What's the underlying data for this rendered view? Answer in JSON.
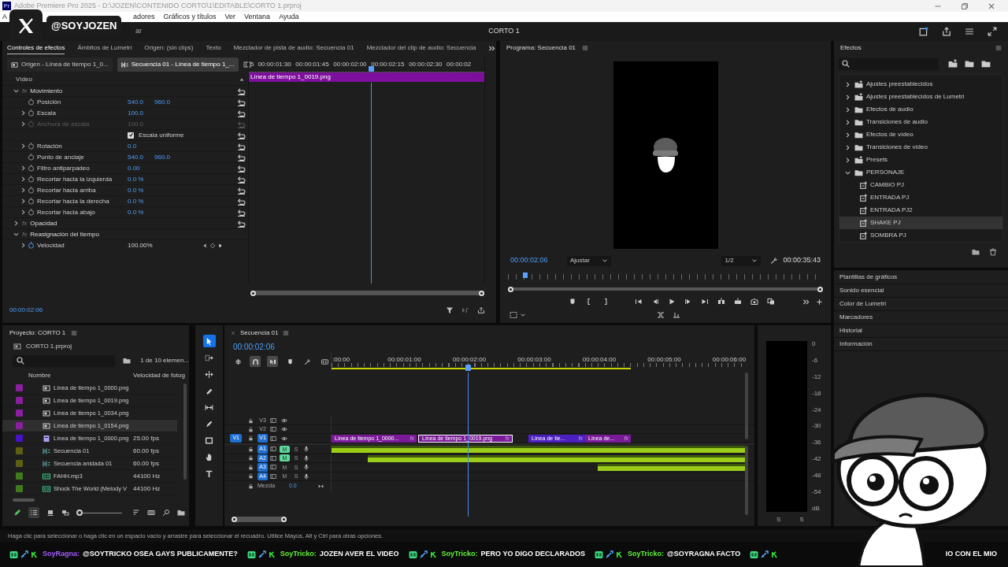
{
  "title_bar": {
    "app_icon": "Pr",
    "title": "Adobe Premiere Pro 2025 - D:\\JOZEN\\CONTENIDO CORTO\\1\\EDITABLE\\CORTO 1.prproj"
  },
  "menu": [
    "A",
    "adores",
    "Gráficos y títulos",
    "Ver",
    "Ventana",
    "Ayuda"
  ],
  "header": {
    "workspace_tab": "ar",
    "project": "CORTO 1"
  },
  "effect_controls": {
    "tabs": [
      {
        "label": "Controles de efectos",
        "selected": true
      },
      {
        "label": "Ámbitos de Lumetri",
        "selected": false
      },
      {
        "label": "Origen: (sin clips)",
        "selected": false
      },
      {
        "label": "Texto",
        "selected": false
      },
      {
        "label": "Mezclador de pista de audio: Secuencia 01",
        "selected": false
      },
      {
        "label": "Mezclador del clip de audio: Secuencia",
        "selected": false
      }
    ],
    "sources": [
      {
        "label": "Origen - Línea de tiempo 1_0...",
        "selected": false
      },
      {
        "label": "Secuencia 01 - Línea de tiempo 1_...",
        "selected": true
      }
    ],
    "section": "Vídeo",
    "effects": [
      {
        "name": "Movimiento",
        "fx": "fx",
        "expanded": true,
        "reset": true,
        "children": [
          {
            "kind": "property",
            "name": "Posición",
            "values": [
              "540.0",
              "960.0"
            ],
            "expandable": false,
            "disabled": false,
            "animated": false
          },
          {
            "kind": "property",
            "name": "Escala",
            "values": [
              "100.0"
            ],
            "expandable": true,
            "disabled": false,
            "animated": false
          },
          {
            "kind": "property",
            "name": "Anchura de escala",
            "values": [
              "100.0"
            ],
            "expandable": true,
            "disabled": true,
            "animated": false
          },
          {
            "kind": "checkbox",
            "label": "Escala uniforme",
            "checked": true
          },
          {
            "kind": "property",
            "name": "Rotación",
            "values": [
              "0.0"
            ],
            "expandable": true,
            "disabled": false,
            "animated": false
          },
          {
            "kind": "property",
            "name": "Punto de anclaje",
            "values": [
              "540.0",
              "960.0"
            ],
            "expandable": false,
            "disabled": false,
            "animated": false
          },
          {
            "kind": "property",
            "name": "Filtro antiparpadeo",
            "values": [
              "0.00"
            ],
            "expandable": true,
            "disabled": false,
            "animated": false
          },
          {
            "kind": "property",
            "name": "Recortar hacia la izquierda",
            "values": [
              "0.0 %"
            ],
            "expandable": true,
            "disabled": false,
            "animated": false
          },
          {
            "kind": "property",
            "name": "Recortar hacia arriba",
            "values": [
              "0.0 %"
            ],
            "expandable": true,
            "disabled": false,
            "animated": false
          },
          {
            "kind": "property",
            "name": "Recortar hacia la derecha",
            "values": [
              "0.0 %"
            ],
            "expandable": true,
            "disabled": false,
            "animated": false
          },
          {
            "kind": "property",
            "name": "Recortar hacia abajo",
            "values": [
              "0.0 %"
            ],
            "expandable": true,
            "disabled": false,
            "animated": false
          }
        ]
      },
      {
        "name": "Opacidad",
        "fx": "fx",
        "expanded": false,
        "reset": true
      },
      {
        "name": "Reasignación del tiempo",
        "fx": "fx",
        "expanded": true,
        "reset": false,
        "children": [
          {
            "kind": "property",
            "name": "Velocidad",
            "values": [
              "100.00%"
            ],
            "expandable": true,
            "disabled": false,
            "animated": true
          }
        ]
      }
    ],
    "ruler": [
      "5",
      "00:00:01:30",
      "00:00:01:45",
      "00:00:02:00",
      "00:00:02:15",
      "00:00:02:30",
      "00:00:02"
    ],
    "clip": "Línea de tiempo 1_0019.png",
    "timecode": "00:00:02:06"
  },
  "program": {
    "title": "Programa: Secuencia 01",
    "timecode": "00:00:02:06",
    "fit": "Ajustar",
    "resolution": "1/2",
    "duration": "00:00:35:43"
  },
  "effects_panel": {
    "title": "Efectos",
    "items": [
      {
        "label": "Ajustes preestablecidos",
        "kind": "preset_bin",
        "expanded": false,
        "selected": false
      },
      {
        "label": "Ajustes preestablecidos de Lumetri",
        "kind": "preset_bin",
        "expanded": false,
        "selected": false
      },
      {
        "label": "Efectos de audio",
        "kind": "folder",
        "expanded": false,
        "selected": false
      },
      {
        "label": "Transiciones de audio",
        "kind": "folder",
        "expanded": false,
        "selected": false
      },
      {
        "label": "Efectos de vídeo",
        "kind": "folder",
        "expanded": false,
        "selected": false
      },
      {
        "label": "Transiciones de vídeo",
        "kind": "folder",
        "expanded": false,
        "selected": false
      },
      {
        "label": "Presets",
        "kind": "preset_bin",
        "expanded": false,
        "selected": false
      },
      {
        "label": "PERSONAJE",
        "kind": "folder",
        "expanded": true,
        "selected": false,
        "children": [
          {
            "label": "CAMBIO PJ",
            "kind": "preset",
            "selected": false
          },
          {
            "label": "ENTRADA PJ",
            "kind": "preset",
            "selected": false
          },
          {
            "label": "ENTRADA PJ2",
            "kind": "preset",
            "selected": false
          },
          {
            "label": "SHAKE PJ",
            "kind": "preset",
            "selected": true
          },
          {
            "label": "SOMBRA PJ",
            "kind": "preset",
            "selected": false
          }
        ]
      }
    ]
  },
  "side_panels": [
    "Plantillas de gráficos",
    "Sonido esencial",
    "Color de Lumetri",
    "Marcadores",
    "Historial",
    "Información"
  ],
  "project": {
    "title": "Proyecto: CORTO 1",
    "file": "CORTO 1.prproj",
    "count": "1 de 10 elemen...",
    "columns": [
      "Nombre",
      "Velocidad de fotog"
    ],
    "rows": [
      {
        "name": "Línea de tiempo 1_0000.png",
        "kind": "image",
        "color": "#8a1fa0",
        "selected": false
      },
      {
        "name": "Línea de tiempo 1_0019.png",
        "kind": "image",
        "color": "#8a1fa0",
        "selected": false
      },
      {
        "name": "Línea de tiempo 1_0034.png",
        "kind": "image",
        "color": "#8a1fa0",
        "selected": false
      },
      {
        "name": "Línea de tiempo 1_0154.png",
        "kind": "image",
        "color": "#8a1fa0",
        "selected": true
      },
      {
        "name": "Línea de tiempo 1_0000.png",
        "rate": "25.00 fps",
        "kind": "graphic",
        "color": "#4a12c8",
        "selected": false
      },
      {
        "name": "Secuencia 01",
        "rate": "60.00 fps",
        "kind": "sequence",
        "color": "#5e5e14",
        "selected": false
      },
      {
        "name": "Secuencia anidada 01",
        "rate": "60.00 fps",
        "kind": "sequence",
        "color": "#5e5e14",
        "selected": false
      },
      {
        "name": "FAHH.mp3",
        "rate": "44100 Hz",
        "kind": "audio",
        "color": "#3f7a1c",
        "selected": false
      },
      {
        "name": "Shock The World (Melody V",
        "rate": "44100 Hz",
        "kind": "audio",
        "color": "#3f7a1c",
        "selected": false
      }
    ],
    "thumbnail_zoom": {
      "level": 0
    }
  },
  "tools": [
    {
      "selected": true
    },
    {
      "selected": false
    },
    {
      "selected": false
    },
    {
      "selected": false
    },
    {
      "selected": false
    },
    {
      "selected": false
    },
    {
      "selected": false
    },
    {
      "selected": false
    },
    {
      "selected": false
    }
  ],
  "timeline": {
    "title": "Secuencia 01",
    "timecode": "00:00:02:06",
    "toolbar": [
      {
        "selected": false
      },
      {
        "selected": true
      },
      {
        "selected": true
      },
      {
        "selected": false
      },
      {
        "selected": false
      },
      {
        "selected": false
      }
    ],
    "ruler": [
      ":00:00",
      "00:00:01:00",
      "00:00:02:00",
      "00:00:03:00",
      "00:00:04:00",
      "00:00:05:00",
      "00:00:06:00"
    ],
    "video_tracks": [
      {
        "name": "V3",
        "targeted": false
      },
      {
        "name": "V2",
        "targeted": false
      },
      {
        "name": "V1",
        "targeted": true,
        "source_patch": "V1"
      }
    ],
    "audio_tracks": [
      {
        "name": "A1",
        "mute": "M",
        "solo": "S",
        "muted": true
      },
      {
        "name": "A2",
        "mute": "M",
        "solo": "S",
        "muted": true
      },
      {
        "name": "A3",
        "mute": "M",
        "solo": "S",
        "muted": false
      },
      {
        "name": "A4",
        "mute": "M",
        "solo": "S",
        "muted": false
      }
    ],
    "mix": {
      "label": "Mezcla",
      "value": "0.0"
    },
    "video_clips": [
      {
        "label": "Línea de tiempo 1_0000...",
        "fx": "fx",
        "color": "#7a1a98",
        "selected": false
      },
      {
        "label": "Línea de tiempo 1_0019.png",
        "fx": "fx",
        "color": "#7a1a98",
        "selected": true
      },
      {
        "label": "Línea de tie...",
        "fx": "fx",
        "color": "#4b1fc0",
        "selected": false
      },
      {
        "label": "Línea de...",
        "fx": "fx",
        "color": "#7a1a98",
        "selected": false
      }
    ]
  },
  "audio_meter": {
    "scale": [
      "0",
      "-6",
      "-12",
      "-18",
      "-24",
      "-30",
      "-36",
      "-42",
      "-48",
      "-54",
      "dB"
    ],
    "channels": [
      "S",
      "S"
    ]
  },
  "status_bar": "Haga clic para seleccionar o haga clic en un espacio vacío y arrastre para seleccionar el recuadro. Utilice Mayús, Alt y Ctrl para otras opciones.",
  "overlay": {
    "handle": "@SOYJOZEN",
    "chat": [
      {
        "user": "SoyRagna:",
        "color": "#a35cff",
        "text": "@SOYTRICKO OSEA GAYS PUBLICAMENTE?"
      },
      {
        "user": "SoyTricko:",
        "color": "#62f23a",
        "text": "JOZEN AVER EL VIDEO"
      },
      {
        "user": "SoyTricko:",
        "color": "#62f23a",
        "text": "PERO YO DIGO DECLARADOS"
      },
      {
        "user": "SoyTricko:",
        "color": "#62f23a",
        "text": "@SOYRAGNA FACTO"
      },
      {
        "text": "IO CON EL MIO"
      }
    ]
  }
}
